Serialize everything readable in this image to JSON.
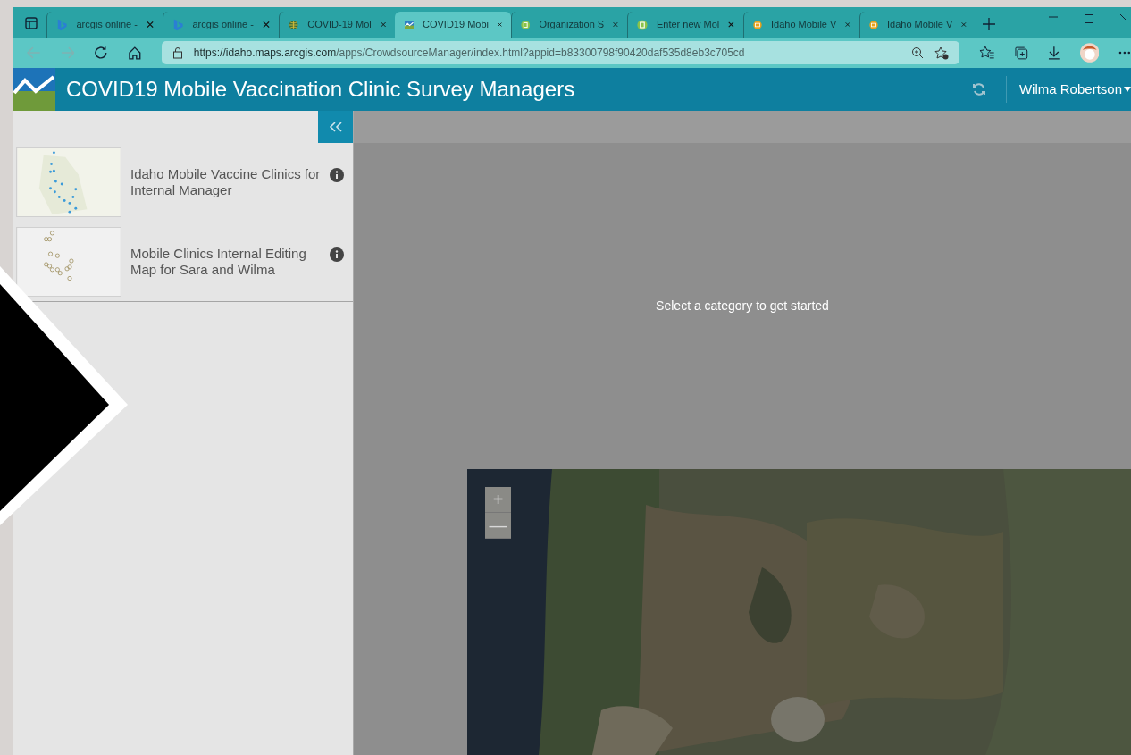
{
  "browser": {
    "tabs": [
      {
        "label": "arcgis online - ",
        "kind": "bing",
        "selected": false
      },
      {
        "label": "arcgis online - ",
        "kind": "bing",
        "selected": false
      },
      {
        "label": "COVID-19 Mol",
        "kind": "globe",
        "selected": false
      },
      {
        "label": "COVID19 Mobi",
        "kind": "app",
        "selected": true
      },
      {
        "label": "Organization S",
        "kind": "survey",
        "selected": false
      },
      {
        "label": "Enter new Mol",
        "kind": "survey",
        "selected": false
      },
      {
        "label": "Idaho Mobile V",
        "kind": "hub",
        "selected": false
      },
      {
        "label": "Idaho Mobile V",
        "kind": "hub",
        "selected": false
      }
    ],
    "url_host": "https://idaho.maps.arcgis.com",
    "url_path": "/apps/CrowdsourceManager/index.html?appid=b83300798f90420daf535d8eb3c705cd"
  },
  "app": {
    "title": "COVID19 Mobile Vaccination Clinic Survey Managers",
    "user": "Wilma Robertson"
  },
  "sidebar": {
    "items": [
      {
        "title": "Idaho Mobile Vaccine Clinics for Internal Manager",
        "kind": "dots"
      },
      {
        "title": "Mobile Clinics Internal Editing Map for Sara and Wilma",
        "kind": "rings"
      }
    ]
  },
  "main": {
    "message": "Select a category to get started",
    "zoom": [
      "+",
      "—"
    ]
  }
}
